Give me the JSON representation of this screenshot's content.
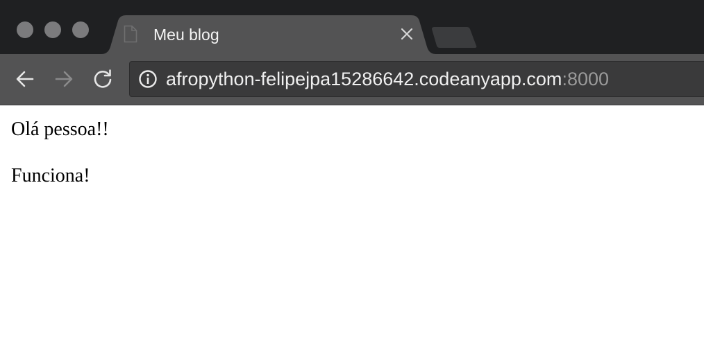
{
  "tab": {
    "title": "Meu blog",
    "favicon": "document-icon",
    "close": "close-icon"
  },
  "toolbar": {
    "back_icon": "arrow-left-icon",
    "forward_icon": "arrow-right-icon",
    "reload_icon": "reload-icon"
  },
  "address_bar": {
    "security_icon": "info-icon",
    "host": "afropython-felipejpa15286642.codeanyapp.com",
    "port": ":8000"
  },
  "page": {
    "paragraphs": [
      "Olá pessoa!!",
      "Funciona!"
    ]
  },
  "colors": {
    "titlebar": "#1f2022",
    "tab_active": "#535354",
    "toolbar": "#535354",
    "omnibox": "#3a3a3b",
    "traffic_light": "#7b7b7d"
  }
}
